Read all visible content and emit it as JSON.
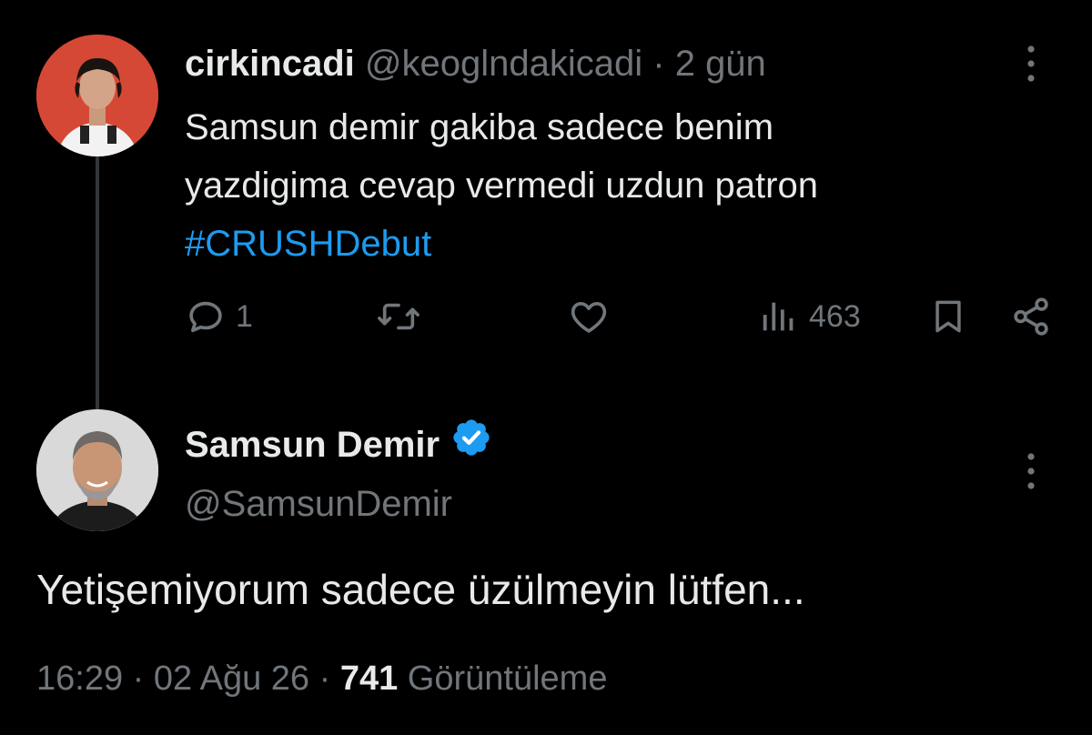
{
  "reply_to": {
    "display_name": "cirkincadi",
    "handle": "@keoglndakicadi",
    "separator": "·",
    "time_ago": "2 gün",
    "text_line1": "Samsun demir gakiba sadece benim",
    "text_line2": "yazdigima cevap vermedi uzdun patron",
    "hashtag": "#CRUSHDebut",
    "replies": "1",
    "views": "463",
    "icons": [
      "reply-icon",
      "retweet-icon",
      "like-icon",
      "views-icon",
      "bookmark-icon",
      "share-icon",
      "more-icon"
    ]
  },
  "main_tweet": {
    "display_name": "Samsun Demir",
    "verified": true,
    "handle": "@SamsunDemir",
    "text": "Yetişemiyorum sadece üzülmeyin lütfen...",
    "time": "16:29",
    "dot1": "·",
    "date": "02 Ağu 26",
    "dot2": "·",
    "views_count": "741",
    "views_label": "Görüntüleme"
  },
  "colors": {
    "background": "#000000",
    "text": "#e7e9ea",
    "muted": "#71767b",
    "link": "#1d9bf0",
    "verified_badge": "#1d9bf0",
    "thread_line": "#333639"
  }
}
